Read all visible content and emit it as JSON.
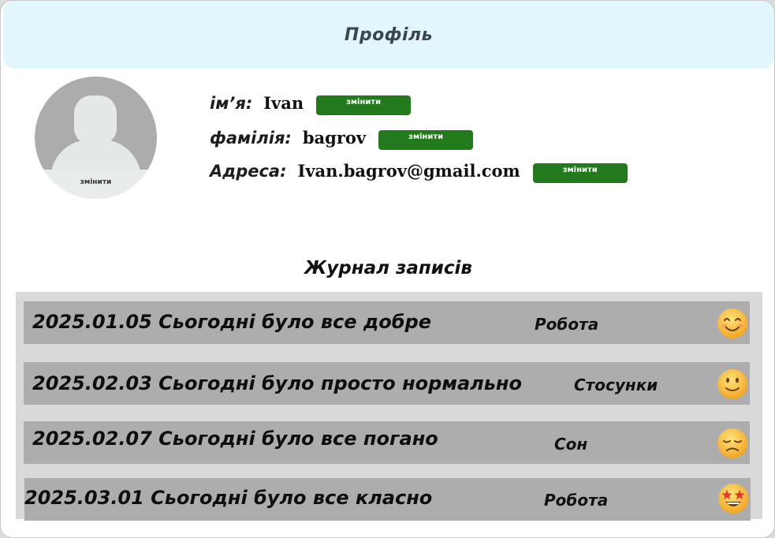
{
  "header": {
    "title": "Профіль"
  },
  "avatar": {
    "change_label": "змінити",
    "icon": "user-silhouette-icon"
  },
  "profile": {
    "fields": [
      {
        "label": "ім’я:",
        "value": "Ivan",
        "button": "змінити"
      },
      {
        "label": "фамілія:",
        "value": "bagrov",
        "button": "змінити"
      },
      {
        "label": "Адреса:",
        "value": "Ivan.bagrov@gmail.com",
        "button": "змінити"
      }
    ]
  },
  "journal": {
    "title": "Журнал записів",
    "entries": [
      {
        "text": "2025.01.05 Сьогодні було все добре",
        "category": "Робота",
        "mood": "smiling-face-icon"
      },
      {
        "text": "2025.02.03 Сьогодні було просто нормально",
        "category": "Стосунки",
        "mood": "slightly-smiling-face-icon"
      },
      {
        "text": "2025.02.07 Сьогодні було все погано",
        "category": "Сон",
        "mood": "disappointed-face-icon"
      },
      {
        "text": "2025.03.01 Сьогодні було все класно",
        "category": "Робота",
        "mood": "star-struck-face-icon"
      }
    ]
  },
  "colors": {
    "header_bg": "#e2f6fd",
    "button_green": "#237a1c",
    "entry_bg": "#adadad",
    "journal_bg": "#d9d9d9"
  }
}
